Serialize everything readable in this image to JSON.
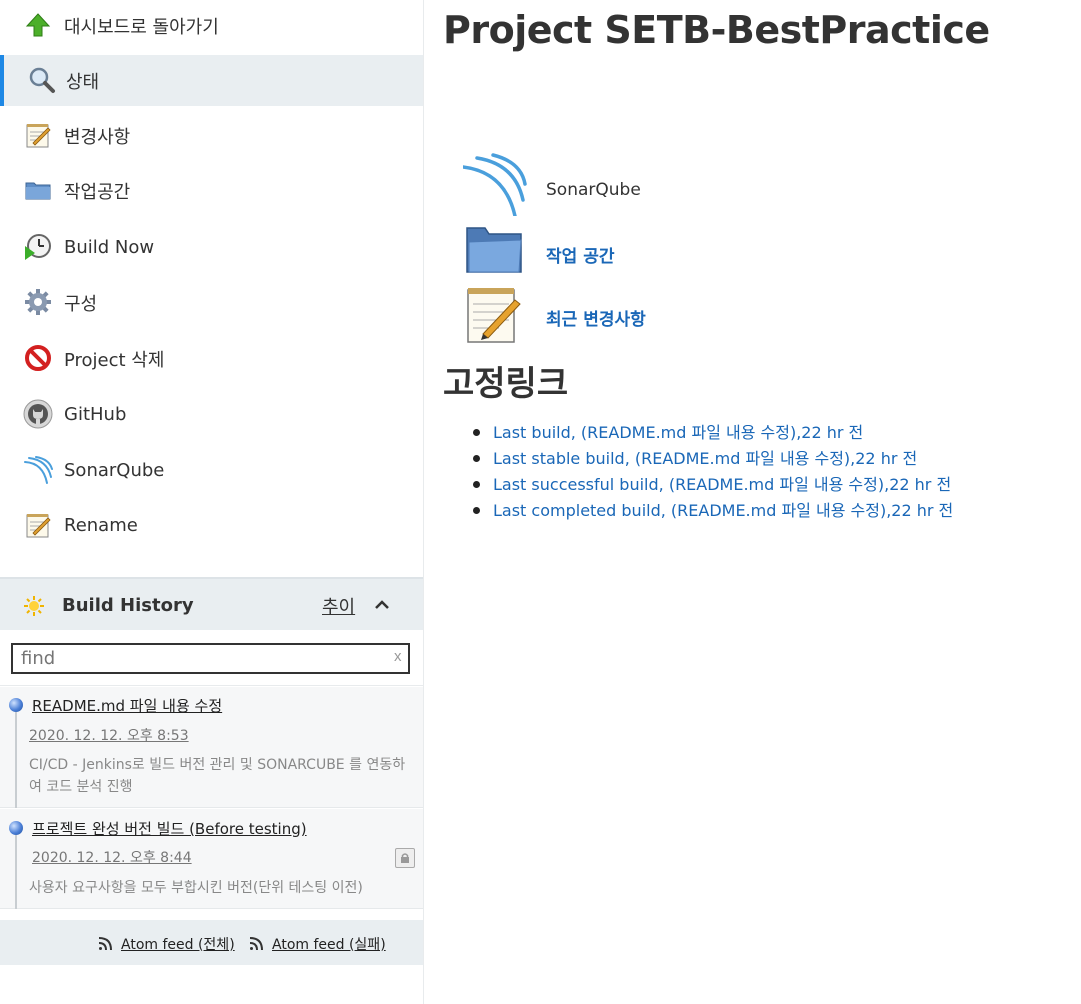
{
  "sidebar": {
    "tasks": [
      {
        "label": "대시보드로 돌아가기",
        "icon": "up-arrow-icon"
      },
      {
        "label": "상태",
        "icon": "search-icon",
        "active": true
      },
      {
        "label": "변경사항",
        "icon": "notepad-icon"
      },
      {
        "label": "작업공간",
        "icon": "folder-icon"
      },
      {
        "label": "Build Now",
        "icon": "clock-play-icon"
      },
      {
        "label": "구성",
        "icon": "gear-icon"
      },
      {
        "label": "Project 삭제",
        "icon": "no-entry-icon"
      },
      {
        "label": "GitHub",
        "icon": "github-icon"
      },
      {
        "label": "SonarQube",
        "icon": "sonarqube-icon"
      },
      {
        "label": "Rename",
        "icon": "notepad-icon"
      }
    ]
  },
  "build_history": {
    "title": "Build History",
    "trend_label": "추이",
    "search_placeholder": "find",
    "clear_label": "x",
    "builds": [
      {
        "title": "README.md 파일 내용 수정",
        "date": "2020. 12. 12. 오후 8:53",
        "description": "CI/CD - Jenkins로 빌드 버전 관리 및 SONARCUBE 를 연동하여 코드 분석 진행"
      },
      {
        "title": "프로젝트 완성 버전 빌드 (Before testing)",
        "date": "2020. 12. 12. 오후 8:44",
        "description": "사용자 요구사항을 모두 부합시킨 버전(단위 테스팅 이전)"
      }
    ],
    "feeds": [
      {
        "label": "Atom feed (전체)"
      },
      {
        "label": "Atom feed (실패)"
      }
    ]
  },
  "main": {
    "title": "Project SETB-BestPractice",
    "links": [
      {
        "label": "SonarQube",
        "icon": "sonarqube-icon"
      },
      {
        "label": "작업 공간",
        "icon": "folder-icon"
      },
      {
        "label": "최근 변경사항",
        "icon": "notepad-icon"
      }
    ],
    "permalinks_title": "고정링크",
    "permalinks": [
      "Last build, (README.md 파일 내용 수정),22 hr 전",
      "Last stable build, (README.md 파일 내용 수정),22 hr 전",
      "Last successful build, (README.md 파일 내용 수정),22 hr 전",
      "Last completed build, (README.md 파일 내용 수정),22 hr 전"
    ]
  },
  "colors": {
    "link": "#1a67b7",
    "active_border": "#1e88e5",
    "panel_bg": "#e9eef1"
  }
}
